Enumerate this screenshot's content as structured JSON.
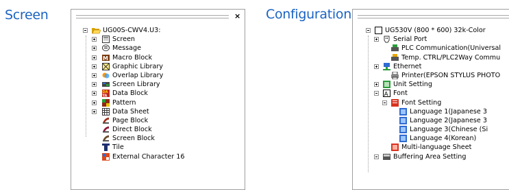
{
  "headings": {
    "screen": "Screen",
    "configuration": "Configuration"
  },
  "screen_tree": {
    "root": "UG00S-CWV4.U3:",
    "items": [
      {
        "label": "Screen",
        "icon": "screen-icon",
        "expander": "plus"
      },
      {
        "label": "Message",
        "icon": "message-icon",
        "expander": "plus"
      },
      {
        "label": "Macro Block",
        "icon": "macro-block-icon",
        "expander": "plus"
      },
      {
        "label": "Graphic Library",
        "icon": "graphic-library-icon",
        "expander": "plus"
      },
      {
        "label": "Overlap Library",
        "icon": "overlap-library-icon",
        "expander": "plus"
      },
      {
        "label": "Screen Library",
        "icon": "screen-library-icon",
        "expander": "plus"
      },
      {
        "label": "Data Block",
        "icon": "data-block-icon",
        "expander": "plus"
      },
      {
        "label": "Pattern",
        "icon": "pattern-icon",
        "expander": "plus"
      },
      {
        "label": "Data Sheet",
        "icon": "data-sheet-icon",
        "expander": "plus"
      },
      {
        "label": "Page Block",
        "icon": "page-block-icon",
        "expander": "none"
      },
      {
        "label": "Direct Block",
        "icon": "direct-block-icon",
        "expander": "none"
      },
      {
        "label": "Screen Block",
        "icon": "screen-block-icon",
        "expander": "none"
      },
      {
        "label": "Tile",
        "icon": "tile-icon",
        "expander": "none"
      },
      {
        "label": "External Character 16",
        "icon": "external-character-icon",
        "expander": "none"
      }
    ]
  },
  "config_tree": {
    "items": [
      {
        "label": "UG530V (800 * 600) 32k-Color",
        "icon": "monitor-icon",
        "expander": "minus"
      },
      {
        "label": "Serial Port",
        "icon": "serial-port-icon",
        "expander": "plus"
      },
      {
        "label": "PLC Communication(Universal",
        "icon": "plc-communication-icon",
        "expander": "none"
      },
      {
        "label": "Temp. CTRL/PLC2Way Commu",
        "icon": "temp-ctrl-icon",
        "expander": "none"
      },
      {
        "label": "Ethernet",
        "icon": "ethernet-icon",
        "expander": "plus"
      },
      {
        "label": "Printer(EPSON STYLUS PHOTO",
        "icon": "printer-icon",
        "expander": "none"
      },
      {
        "label": "Unit Setting",
        "icon": "unit-setting-icon",
        "expander": "plus"
      },
      {
        "label": "Font",
        "icon": "font-icon",
        "expander": "minus"
      },
      {
        "label": "Font Setting",
        "icon": "font-setting-icon",
        "expander": "minus"
      },
      {
        "label": "Language 1(Japanese 3",
        "icon": "language-icon",
        "expander": "none"
      },
      {
        "label": "Language 2(Japanese 3",
        "icon": "language-icon",
        "expander": "none"
      },
      {
        "label": "Language 3(Chinese (Si",
        "icon": "language-icon",
        "expander": "none"
      },
      {
        "label": "Language 4(Korean)",
        "icon": "language-icon",
        "expander": "none"
      },
      {
        "label": "Multi-language Sheet",
        "icon": "multi-language-sheet-icon",
        "expander": "none"
      },
      {
        "label": "Buffering Area Setting",
        "icon": "buffering-area-icon",
        "expander": "minus"
      }
    ]
  },
  "colors": {
    "heading": "#1a63c2",
    "border": "#9e9e9e"
  }
}
